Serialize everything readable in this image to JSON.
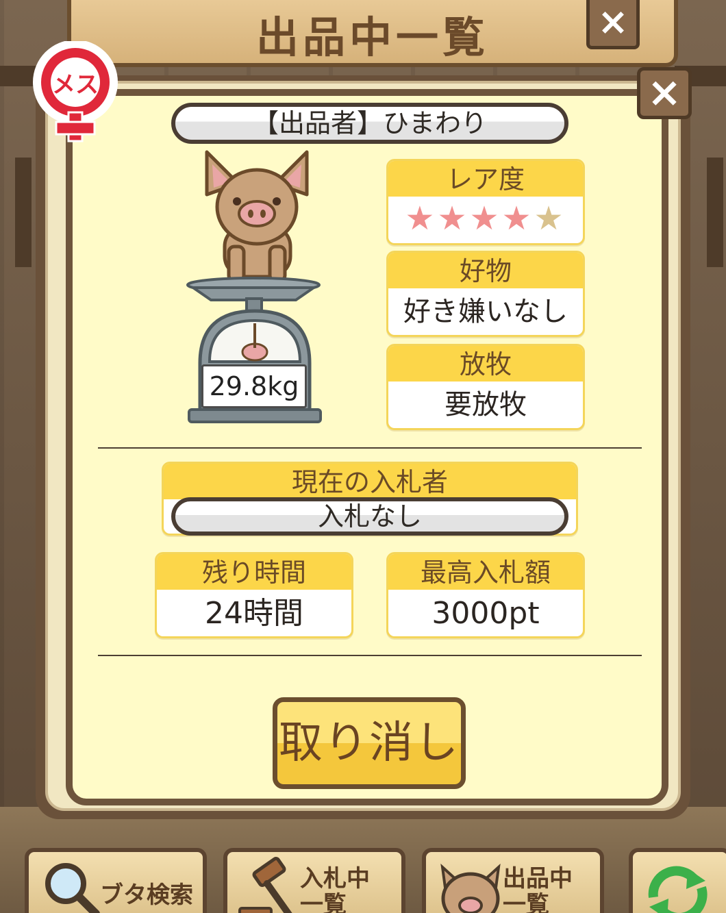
{
  "screen_title": "出品中一覧",
  "gender_label": "メス",
  "seller": {
    "prefix": "【出品者】",
    "name": "ひまわり"
  },
  "pig": {
    "weight": "29.8kg"
  },
  "rarity": {
    "label": "レア度",
    "stars_filled": 4,
    "stars_total": 5
  },
  "favorite": {
    "label": "好物",
    "value": "好き嫌いなし"
  },
  "grazing": {
    "label": "放牧",
    "value": "要放牧"
  },
  "current_bidder": {
    "label": "現在の入札者",
    "value": "入札なし"
  },
  "remaining_time": {
    "label": "残り時間",
    "value": "24時間"
  },
  "highest_bid": {
    "label": "最高入札額",
    "value": "3000pt"
  },
  "cancel_label": "取り消し",
  "bottom_nav": [
    {
      "label": "ブタ検索",
      "icon": "magnifier-icon"
    },
    {
      "label": "入札中\n一覧",
      "icon": "gavel-icon"
    },
    {
      "label": "出品中\n一覧",
      "icon": "pig-face-icon"
    },
    {
      "label": "",
      "icon": "refresh-icon"
    }
  ],
  "colors": {
    "panel": "#fffbc8",
    "header_yellow": "#fcd649",
    "frame_brown": "#6e553c",
    "star_on": "#f08f8f",
    "star_off": "#d9c28e",
    "gender_red": "#e0283a"
  }
}
